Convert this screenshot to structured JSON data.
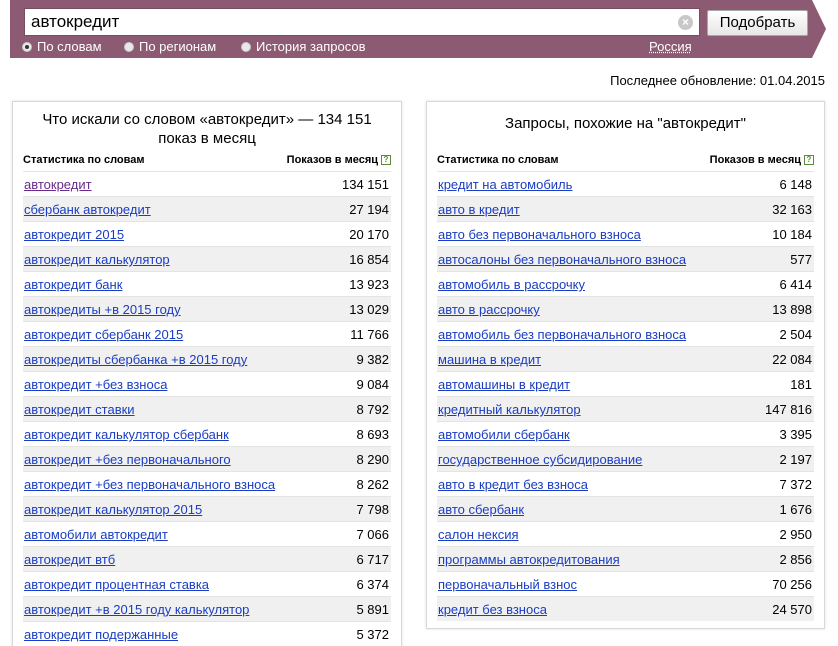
{
  "search": {
    "value": "автокредит",
    "submit_label": "Подобрать",
    "modes": [
      {
        "label": "По словам",
        "checked": true
      },
      {
        "label": "По регионам",
        "checked": false
      },
      {
        "label": "История запросов",
        "checked": false
      }
    ],
    "region": "Россия",
    "clear_icon": "×"
  },
  "last_update": "Последнее обновление: 01.04.2015",
  "left_panel": {
    "title": "Что искали со словом «автокредит» — 134 151 показ в месяц",
    "col_query": "Статистика по словам",
    "col_count": "Показов в месяц",
    "help_glyph": "?",
    "rows": [
      {
        "q": "автокредит",
        "n": "134 151"
      },
      {
        "q": "сбербанк автокредит",
        "n": "27 194"
      },
      {
        "q": "автокредит 2015",
        "n": "20 170"
      },
      {
        "q": "автокредит калькулятор",
        "n": "16 854"
      },
      {
        "q": "автокредит банк",
        "n": "13 923"
      },
      {
        "q": "автокредиты +в 2015 году",
        "n": "13 029"
      },
      {
        "q": "автокредит сбербанк 2015",
        "n": "11 766"
      },
      {
        "q": "автокредиты сбербанка +в 2015 году",
        "n": "9 382"
      },
      {
        "q": "автокредит +без взноса",
        "n": "9 084"
      },
      {
        "q": "автокредит ставки",
        "n": "8 792"
      },
      {
        "q": "автокредит калькулятор сбербанк",
        "n": "8 693"
      },
      {
        "q": "автокредит +без первоначального",
        "n": "8 290"
      },
      {
        "q": "автокредит +без первоначального взноса",
        "n": "8 262"
      },
      {
        "q": "автокредит калькулятор 2015",
        "n": "7 798"
      },
      {
        "q": "автомобили автокредит",
        "n": "7 066"
      },
      {
        "q": "автокредит втб",
        "n": "6 717"
      },
      {
        "q": "автокредит процентная ставка",
        "n": "6 374"
      },
      {
        "q": "автокредит +в 2015 году калькулятор",
        "n": "5 891"
      },
      {
        "q": "автокредит подержанные",
        "n": "5 372"
      }
    ]
  },
  "right_panel": {
    "title": "Запросы, похожие на \"автокредит\"",
    "col_query": "Статистика по словам",
    "col_count": "Показов в месяц",
    "help_glyph": "?",
    "rows": [
      {
        "q": "кредит на автомобиль",
        "n": "6 148"
      },
      {
        "q": "авто в кредит",
        "n": "32 163"
      },
      {
        "q": "авто без первоначального взноса",
        "n": "10 184"
      },
      {
        "q": "автосалоны без первоначального взноса",
        "n": "577"
      },
      {
        "q": "автомобиль в рассрочку",
        "n": "6 414"
      },
      {
        "q": "авто в рассрочку",
        "n": "13 898"
      },
      {
        "q": "автомобиль без первоначального взноса",
        "n": "2 504"
      },
      {
        "q": "машина в кредит",
        "n": "22 084"
      },
      {
        "q": "автомашины в кредит",
        "n": "181"
      },
      {
        "q": "кредитный калькулятор",
        "n": "147 816"
      },
      {
        "q": "автомобили сбербанк",
        "n": "3 395"
      },
      {
        "q": "государственное субсидирование",
        "n": "2 197"
      },
      {
        "q": "авто в кредит без взноса",
        "n": "7 372"
      },
      {
        "q": "авто сбербанк",
        "n": "1 676"
      },
      {
        "q": "салон нексия",
        "n": "2 950"
      },
      {
        "q": "программы автокредитования",
        "n": "2 856"
      },
      {
        "q": "первоначальный взнос",
        "n": "70 256"
      },
      {
        "q": "кредит без взноса",
        "n": "24 570"
      }
    ]
  },
  "colors": {
    "header_bg": "#8c5a72",
    "link": "#1a3dc1",
    "visited_link": "#6a2a8a",
    "alt_row": "#f0f0f0"
  }
}
